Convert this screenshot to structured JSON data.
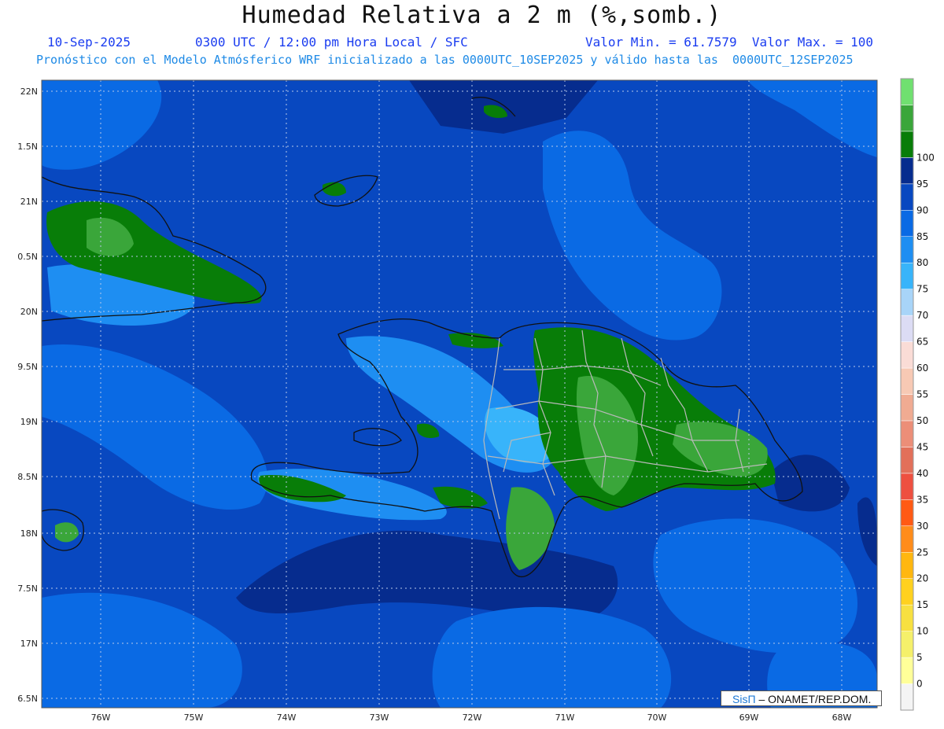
{
  "title": "Humedad Relativa a 2 m (%,somb.)",
  "subtitle": {
    "date": "10-Sep-2025",
    "time": "0300 UTC / 12:00 pm Hora Local / SFC",
    "stats": "Valor Min. = 61.7579  Valor Max. = 100"
  },
  "description": "Pronóstico con el Modelo Atmósferico WRF inicializado a las 0000UTC_10SEP2025 y válido hasta las  0000UTC_12SEP2025",
  "axes": {
    "lat_labels": [
      "22N",
      "1.5N",
      "21N",
      "0.5N",
      "20N",
      "9.5N",
      "19N",
      "8.5N",
      "18N",
      "7.5N",
      "17N",
      "6.5N"
    ],
    "lon_labels": [
      "76W",
      "75W",
      "74W",
      "73W",
      "72W",
      "71W",
      "70W",
      "69W",
      "68W"
    ]
  },
  "colorbar": {
    "labels": [
      "0",
      "5",
      "10",
      "15",
      "20",
      "25",
      "30",
      "35",
      "40",
      "45",
      "50",
      "55",
      "60",
      "65",
      "70",
      "75",
      "80",
      "85",
      "90",
      "95",
      "100"
    ],
    "colors": [
      "#f4f4f4",
      "#ffff99",
      "#f5f06a",
      "#f7e040",
      "#ffd11f",
      "#ffb70f",
      "#ff8c1a",
      "#ff5a14",
      "#ee5040",
      "#e2705a",
      "#ec8e78",
      "#f0ab92",
      "#f7c9b4",
      "#fadcd6",
      "#dcdcf4",
      "#a8d4f8",
      "#38b4fa",
      "#1e8ef2",
      "#0a6ae4",
      "#0848c0",
      "#062c8e",
      "#087d08",
      "#3aa63a",
      "#70e070"
    ]
  },
  "colors": {
    "rh_80_85": "#0848c0",
    "rh_85_90": "#062c8e",
    "rh_75_80": "#0a6ae4",
    "rh_70_75": "#1e8ef2",
    "rh_90_95": "#087d08",
    "rh_95_100": "#3aa63a"
  },
  "credit": {
    "logo": "SisΠ",
    "text": " – ONAMET/REP.DOM."
  }
}
